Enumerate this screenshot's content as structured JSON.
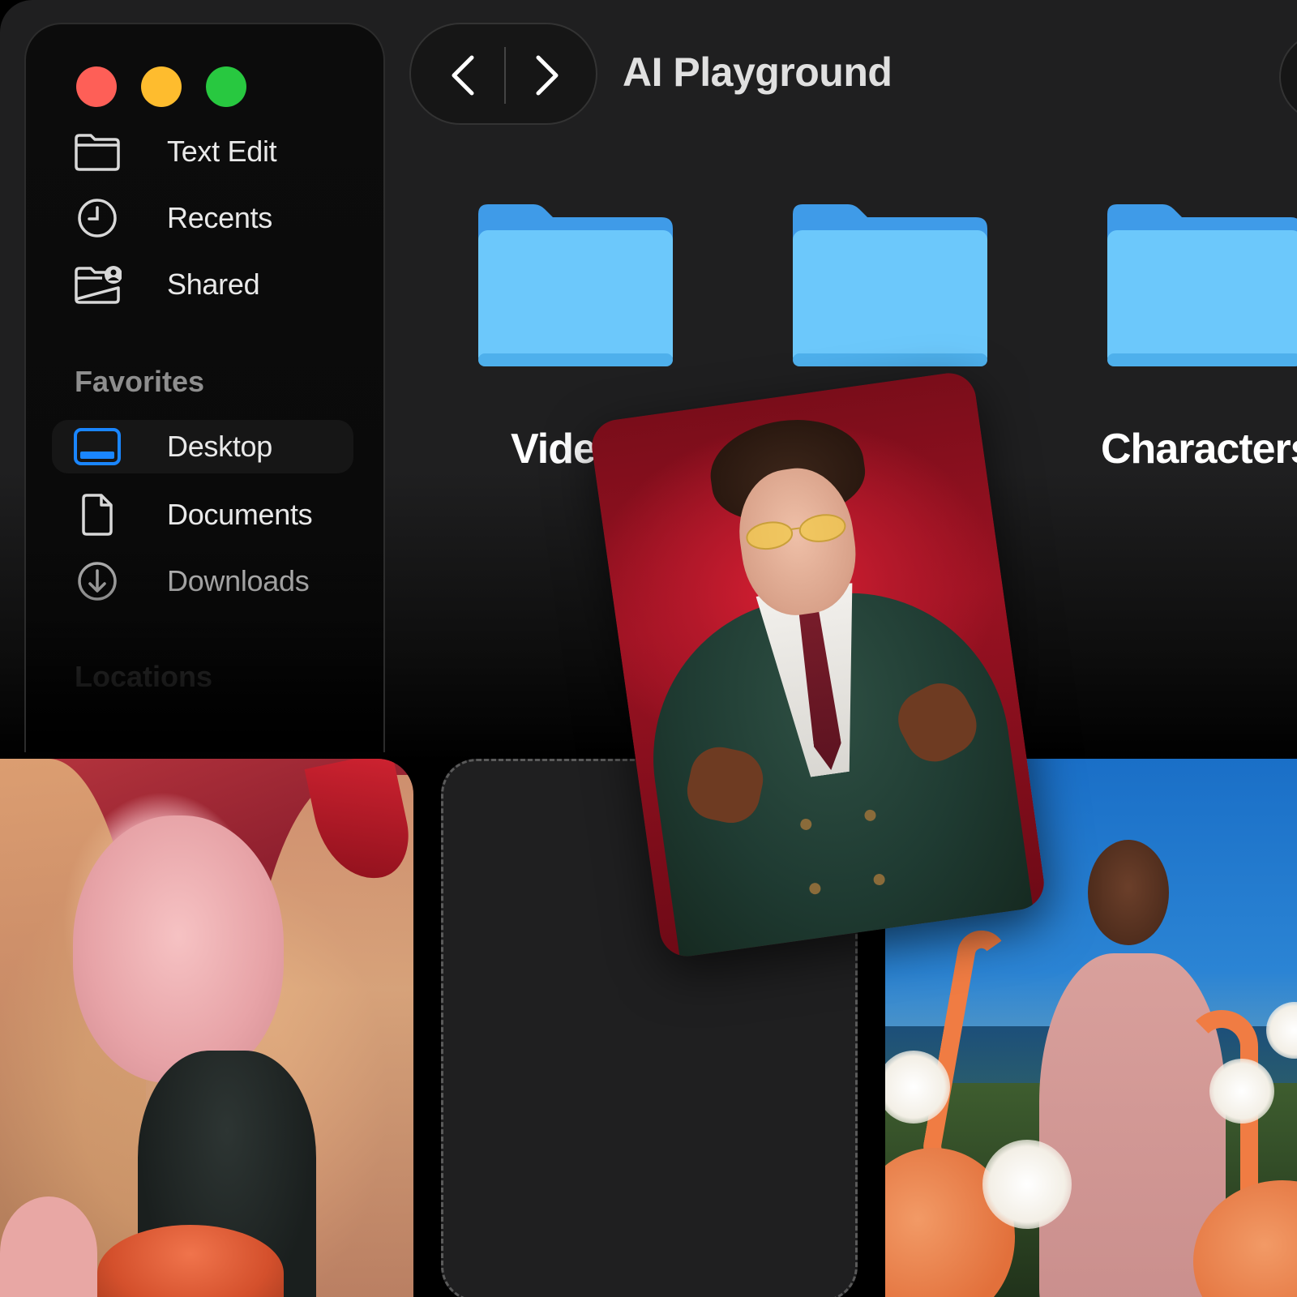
{
  "window": {
    "title": "AI Playground"
  },
  "sidebar": {
    "top_items": [
      {
        "label": "Text Edit",
        "icon": "folder-icon"
      },
      {
        "label": "Recents",
        "icon": "clock-icon"
      },
      {
        "label": "Shared",
        "icon": "shared-folder-icon"
      }
    ],
    "favorites_label": "Favorites",
    "favorites": [
      {
        "label": "Desktop",
        "icon": "desktop-icon",
        "active": true
      },
      {
        "label": "Documents",
        "icon": "document-icon"
      },
      {
        "label": "Downloads",
        "icon": "download-icon"
      }
    ],
    "locations_label": "Locations"
  },
  "folders": [
    {
      "label": "Videos"
    },
    {
      "label": ""
    },
    {
      "label": "Characters"
    }
  ],
  "colors": {
    "accent": "#1a86ff",
    "folder_blue": "#6cc8fb",
    "folder_tab": "#3f9be8",
    "traffic_red": "#fe5f57",
    "traffic_yellow": "#febc2e",
    "traffic_green": "#28c840"
  }
}
